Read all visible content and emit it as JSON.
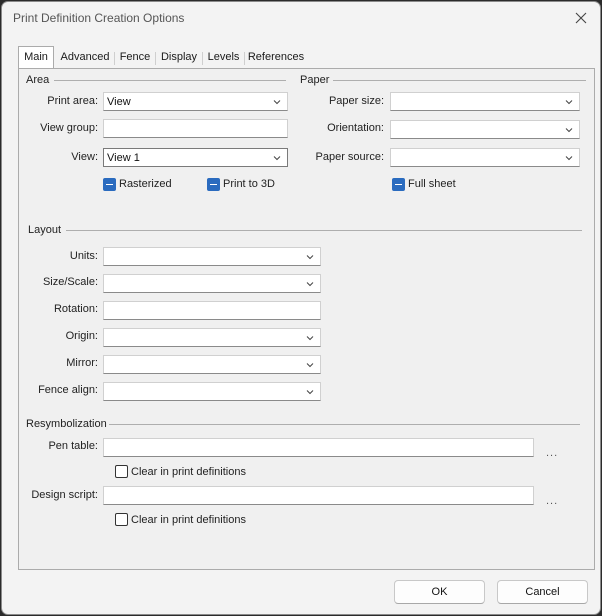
{
  "window": {
    "title": "Print Definition Creation Options",
    "close_icon": "close-icon"
  },
  "tabs": [
    {
      "label": "Main",
      "active": true
    },
    {
      "label": "Advanced"
    },
    {
      "label": "Fence"
    },
    {
      "label": "Display"
    },
    {
      "label": "Levels"
    },
    {
      "label": "References"
    }
  ],
  "area": {
    "title": "Area",
    "print_area_label": "Print area:",
    "print_area_value": "View",
    "view_group_label": "View group:",
    "view_group_value": "",
    "view_label": "View:",
    "view_value": "View 1",
    "rasterized_label": "Rasterized",
    "print_to_3d_label": "Print to 3D"
  },
  "paper": {
    "title": "Paper",
    "paper_size_label": "Paper size:",
    "paper_size_value": "",
    "orientation_label": "Orientation:",
    "orientation_value": "",
    "paper_source_label": "Paper source:",
    "paper_source_value": "",
    "full_sheet_label": "Full sheet"
  },
  "layout": {
    "title": "Layout",
    "units_label": "Units:",
    "size_scale_label": "Size/Scale:",
    "rotation_label": "Rotation:",
    "origin_label": "Origin:",
    "mirror_label": "Mirror:",
    "fence_align_label": "Fence align:"
  },
  "resym": {
    "title": "Resymbolization",
    "pen_table_label": "Pen table:",
    "pen_table_value": "",
    "pen_clear_label": "Clear in print definitions",
    "design_script_label": "Design script:",
    "design_script_value": "",
    "design_clear_label": "Clear in print definitions",
    "browse_label": "..."
  },
  "buttons": {
    "ok": "OK",
    "cancel": "Cancel"
  },
  "colors": {
    "accent": "#2a6bbf"
  }
}
